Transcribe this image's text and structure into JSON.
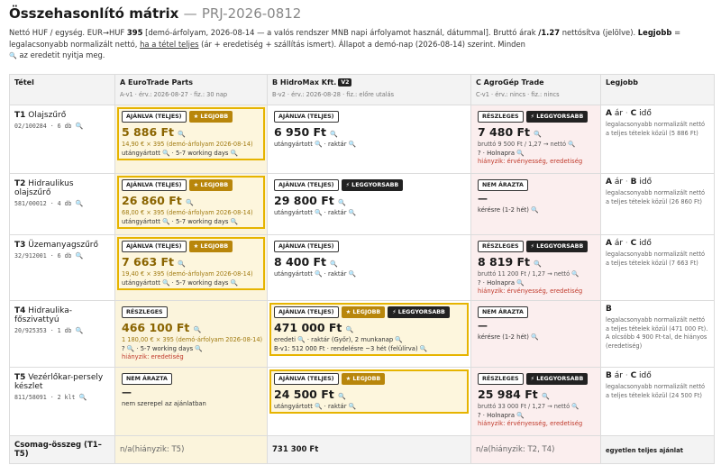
{
  "header": {
    "title": "Összehasonlító mátrix",
    "separator": "—",
    "project_id": "PRJ-2026-0812"
  },
  "intro": {
    "p1": "Nettó HUF / egység. EUR→HUF ",
    "rate": "395",
    "p2": " [demó-árfolyam, 2026-08-14 — a valós rendszer MNB napi árfolyamot használ, dátummal]. Bruttó árak ",
    "vat": "/1.27",
    "p3": " nettósítva (jelölve). ",
    "best_word": "Legjobb",
    "p4": " = legalacsonyabb normalizált nettó, ",
    "underlined": "ha a tétel teljes",
    "p5": " (ár + eredetiség + szállítás ismert). Állapot a demó-nap (2026-08-14) szerint. Minden",
    "p6": " az eredetit nyitja meg."
  },
  "columns": {
    "item": "Tétel",
    "best": "Legjobb",
    "suppliers": [
      {
        "name": "A EuroTrade Parts",
        "version": "",
        "meta": "A-v1 · érv.: 2026-08-27 · fiz.: 30 nap"
      },
      {
        "name": "B HidroMax Kft.",
        "version": "V2",
        "meta": "B-v2 · érv.: 2026-08-28 · fiz.: előre utalás"
      },
      {
        "name": "C AgroGép Trade",
        "version": "",
        "meta": "C-v1 · érv.: nincs · fiz.: nincs"
      }
    ]
  },
  "rows": [
    {
      "id": "T1",
      "name": "Olajszűrő",
      "code": "02/100284 · 6 db",
      "a": {
        "status": "AJÁNLVA (TELJES)",
        "badges": [
          "★ LEGJOBB"
        ],
        "price": "5 886 Ft",
        "sub": "14,90 € × 395 (demó-árfolyam 2026-08-14)",
        "lines": [
          "utángyártott 🔍 · 5-7 working days 🔍"
        ],
        "warn": ""
      },
      "b": {
        "status": "AJÁNLVA (TELJES)",
        "badges": [],
        "price": "6 950 Ft",
        "sub": "",
        "lines": [
          "utángyártott 🔍 · raktár 🔍"
        ],
        "warn": ""
      },
      "c": {
        "status": "RÉSZLEGES",
        "badges": [
          "⚡ LEGGYORSABB"
        ],
        "price": "7 480 Ft",
        "sub": "bruttó 9 500 Ft / 1,27 → nettó 🔍",
        "lines": [
          "? · Holnapra 🔍"
        ],
        "warn": "hiányzik: érvényesség, eredetiség"
      },
      "best": {
        "src": "A",
        "fast": "C",
        "desc": "legalacsonyabb normalizált nettó a teljes tételek közül (5 886 Ft)"
      }
    },
    {
      "id": "T2",
      "name": "Hidraulikus olajszűrő",
      "code": "581/00012 · 4 db",
      "a": {
        "status": "AJÁNLVA (TELJES)",
        "badges": [
          "★ LEGJOBB"
        ],
        "price": "26 860 Ft",
        "sub": "68,00 € × 395 (demó-árfolyam 2026-08-14)",
        "lines": [
          "utángyártott 🔍 · 5-7 working days 🔍"
        ],
        "warn": ""
      },
      "b": {
        "status": "AJÁNLVA (TELJES)",
        "badges": [
          "⚡ LEGGYORSABB"
        ],
        "price": "29 800 Ft",
        "sub": "",
        "lines": [
          "utángyártott 🔍 · raktár 🔍"
        ],
        "warn": ""
      },
      "c": {
        "status": "NEM ÁRAZTA",
        "badges": [],
        "price": "—",
        "sub": "",
        "lines": [
          "kérésre (1-2 hét) 🔍"
        ],
        "warn": ""
      },
      "best": {
        "src": "A",
        "fast": "B",
        "desc": "legalacsonyabb normalizált nettó a teljes tételek közül (26 860 Ft)"
      }
    },
    {
      "id": "T3",
      "name": "Üzemanyagszűrő",
      "code": "32/912001 · 6 db",
      "a": {
        "status": "AJÁNLVA (TELJES)",
        "badges": [
          "★ LEGJOBB"
        ],
        "price": "7 663 Ft",
        "sub": "19,40 € × 395 (demó-árfolyam 2026-08-14)",
        "lines": [
          "utángyártott 🔍 · 5-7 working days 🔍"
        ],
        "warn": ""
      },
      "b": {
        "status": "AJÁNLVA (TELJES)",
        "badges": [],
        "price": "8 400 Ft",
        "sub": "",
        "lines": [
          "utángyártott 🔍 · raktár 🔍"
        ],
        "warn": ""
      },
      "c": {
        "status": "RÉSZLEGES",
        "badges": [
          "⚡ LEGGYORSABB"
        ],
        "price": "8 819 Ft",
        "sub": "bruttó 11 200 Ft / 1,27 → nettó 🔍",
        "lines": [
          "? · Holnapra 🔍"
        ],
        "warn": "hiányzik: érvényesség, eredetiség"
      },
      "best": {
        "src": "A",
        "fast": "C",
        "desc": "legalacsonyabb normalizált nettó a teljes tételek közül (7 663 Ft)"
      }
    },
    {
      "id": "T4",
      "name": "Hidraulika-főszivattyú",
      "code": "20/925353 · 1 db",
      "a": {
        "status": "RÉSZLEGES",
        "badges": [],
        "price": "466 100 Ft",
        "sub": "1 180,00 € × 395 (demó-árfolyam 2026-08-14)",
        "lines": [
          "? 🔍 · 5-7 working days 🔍"
        ],
        "warn": "hiányzik: eredetiség"
      },
      "b": {
        "status": "AJÁNLVA (TELJES)",
        "badges": [
          "★ LEGJOBB",
          "⚡ LEGGYORSABB"
        ],
        "price": "471 000 Ft",
        "sub": "",
        "lines": [
          "eredeti 🔍 · raktár (Győr), 2 munkanap 🔍",
          "B-v1: 512 000 Ft · rendelésre ~3 hét (felülírva) 🔍"
        ],
        "warn": ""
      },
      "c": {
        "status": "NEM ÁRAZTA",
        "badges": [],
        "price": "—",
        "sub": "",
        "lines": [
          "kérésre (1-2 hét) 🔍"
        ],
        "warn": ""
      },
      "best": {
        "src": "B",
        "fast": "",
        "desc": "legalacsonyabb normalizált nettó a teljes tételek közül (471 000 Ft). A olcsóbb 4 900 Ft-tal, de hiányos (eredetiség)"
      }
    },
    {
      "id": "T5",
      "name": "Vezérlőkar-persely készlet",
      "code": "811/58091 · 2 klt",
      "a": {
        "status": "NEM ÁRAZTA",
        "badges": [],
        "price": "—",
        "sub": "",
        "lines": [
          "nem szerepel az ajánlatban"
        ],
        "warn": ""
      },
      "b": {
        "status": "AJÁNLVA (TELJES)",
        "badges": [
          "★ LEGJOBB"
        ],
        "price": "24 500 Ft",
        "sub": "",
        "lines": [
          "utángyártott 🔍 · raktár 🔍"
        ],
        "warn": ""
      },
      "c": {
        "status": "RÉSZLEGES",
        "badges": [
          "⚡ LEGGYORSABB"
        ],
        "price": "25 984 Ft",
        "sub": "bruttó 33 000 Ft / 1,27 → nettó 🔍",
        "lines": [
          "? · Holnapra 🔍"
        ],
        "warn": "hiányzik: érvényesség, eredetiség"
      },
      "best": {
        "src": "B",
        "fast": "C",
        "desc": "legalacsonyabb normalizált nettó a teljes tételek közül (24 500 Ft)"
      }
    }
  ],
  "footer": {
    "label": "Csomag-összeg (T1–T5)",
    "a": "n/a",
    "a_note": "(hiányzik: T5)",
    "b": "731 300 Ft",
    "c": "n/a",
    "c_note": "(hiányzik: T2, T4)",
    "best": "egyetlen teljes ajánlat"
  },
  "labels": {
    "fastest_word": "idő"
  }
}
